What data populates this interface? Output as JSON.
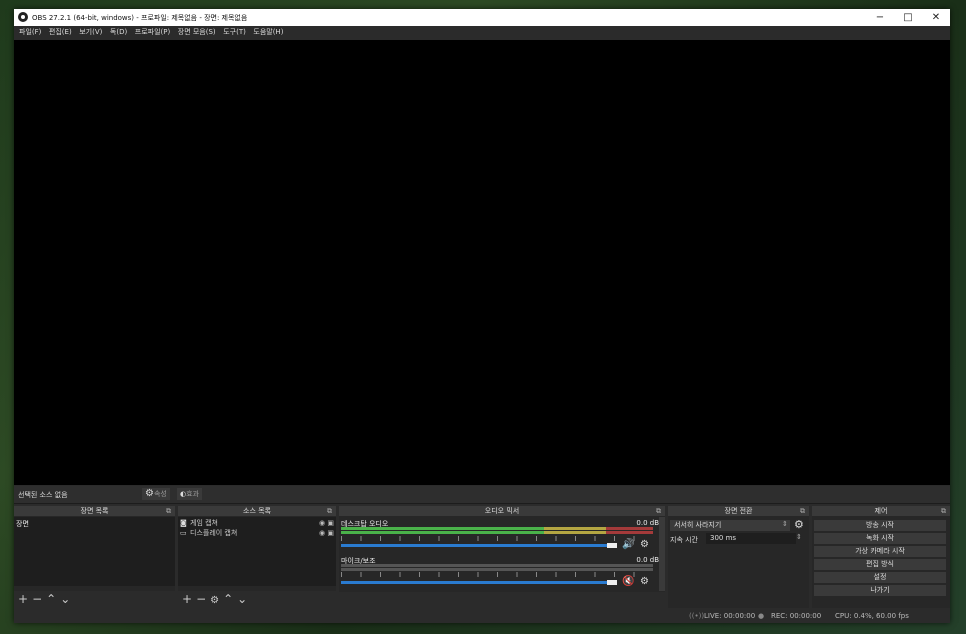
{
  "title": "OBS 27.2.1 (64-bit, windows) - 프로파일: 제목없음 - 장면: 제목없음",
  "window_buttons": {
    "minimize": "−",
    "maximize": "□",
    "close": "✕"
  },
  "menu": [
    "파일(F)",
    "편집(E)",
    "보기(V)",
    "독(D)",
    "프로파일(P)",
    "장면 모음(S)",
    "도구(T)",
    "도움말(H)"
  ],
  "source_bar": {
    "none_selected": "선택된 소스 없음",
    "properties": "속성",
    "filters": "효과"
  },
  "scenes": {
    "title": "장면 목록",
    "items": [
      "장면"
    ]
  },
  "sources": {
    "title": "소스 목록",
    "items": [
      {
        "icon": "gamepad-icon",
        "label": "게임 캡쳐"
      },
      {
        "icon": "monitor-icon",
        "label": "디스플레이 캡쳐"
      }
    ]
  },
  "mixer": {
    "title": "오디오 믹서",
    "channels": [
      {
        "name": "데스크탑 오디오",
        "db": "0.0 dB",
        "muted": false
      },
      {
        "name": "마이크/보조",
        "db": "0.0 dB",
        "muted": true
      }
    ]
  },
  "transitions": {
    "title": "장면 전환",
    "type": "서서히 사라지기",
    "duration_label": "지속 시간",
    "duration": "300 ms"
  },
  "controls": {
    "title": "제어",
    "buttons": [
      "방송 시작",
      "녹화 시작",
      "가상 카메라 시작",
      "편집 방식",
      "설정",
      "나가기"
    ]
  },
  "status": {
    "live": "LIVE: 00:00:00",
    "rec": "REC: 00:00:00",
    "cpu": "CPU: 0.4%, 60.00 fps"
  }
}
